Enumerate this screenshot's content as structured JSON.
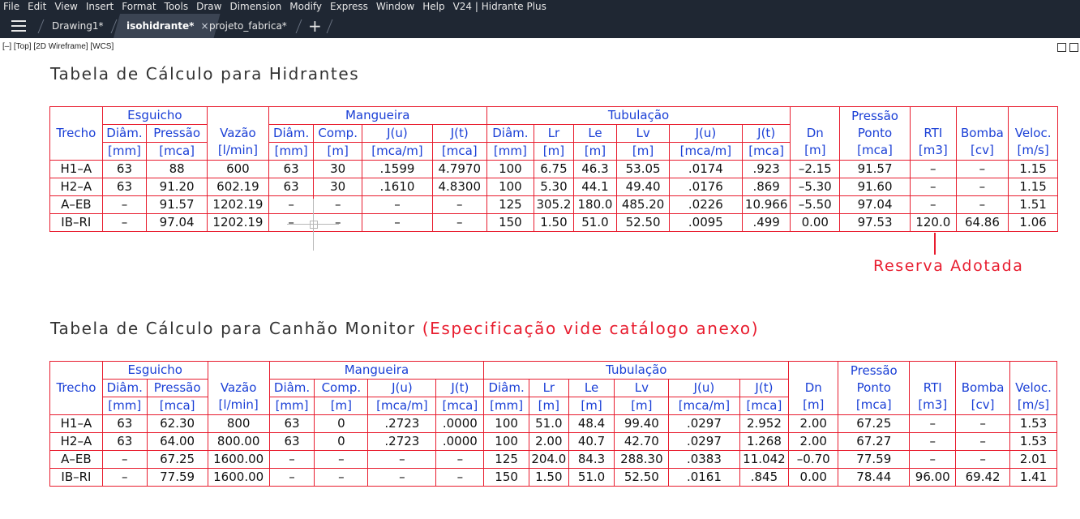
{
  "menu": [
    "File",
    "Edit",
    "View",
    "Insert",
    "Format",
    "Tools",
    "Draw",
    "Dimension",
    "Modify",
    "Express",
    "Window",
    "Help",
    "V24 | Hidrante Plus"
  ],
  "tabs": [
    {
      "label": "Drawing1*",
      "active": false
    },
    {
      "label": "isohidrante*",
      "active": true,
      "close": "×"
    },
    {
      "label": "projeto_fabrica*",
      "active": false
    }
  ],
  "new_tab": "+",
  "viewport_label": "[–] [Top] [2D Wireframe] [WCS]",
  "colors": {
    "grid": "#e81c2e",
    "header_text": "#1a3fd6",
    "value_text": "#111111",
    "annotation": "#e81c2e",
    "app_bar": "#1f2733"
  },
  "table1": {
    "title": "Tabela de Cálculo para Hidrantes",
    "groups": {
      "esguicho": "Esguicho",
      "mangueira": "Mangueira",
      "tubulacao": "Tubulação"
    },
    "headers": {
      "trecho": "Trecho",
      "e_diam": [
        "Diâm.",
        "[mm]"
      ],
      "e_pres": [
        "Pressão",
        "[mca]"
      ],
      "vazao": [
        "Vazão",
        "[l/min]"
      ],
      "m_diam": [
        "Diâm.",
        "[mm]"
      ],
      "m_comp": [
        "Comp.",
        "[m]"
      ],
      "m_ju": [
        "J(u)",
        "[mca/m]"
      ],
      "m_jt": [
        "J(t)",
        "[mca]"
      ],
      "t_diam": [
        "Diâm.",
        "[mm]"
      ],
      "t_lr": [
        "Lr",
        "[m]"
      ],
      "t_le": [
        "Le",
        "[m]"
      ],
      "t_lv": [
        "Lv",
        "[m]"
      ],
      "t_ju": [
        "J(u)",
        "[mca/m]"
      ],
      "t_jt": [
        "J(t)",
        "[mca]"
      ],
      "dn": [
        "Dn",
        "[m]"
      ],
      "pres": [
        "Pressão",
        "Ponto",
        "[mca]"
      ],
      "rti": [
        "RTI",
        "[m3]"
      ],
      "bomba": [
        "Bomba",
        "[cv]"
      ],
      "veloc": [
        "Veloc.",
        "[m/s]"
      ]
    },
    "rows": [
      [
        "H1–A",
        "63",
        "88",
        "600",
        "63",
        "30",
        ".1599",
        "4.7970",
        "100",
        "6.75",
        "46.3",
        "53.05",
        ".0174",
        ".923",
        "–2.15",
        "91.57",
        "–",
        "–",
        "1.15"
      ],
      [
        "H2–A",
        "63",
        "91.20",
        "602.19",
        "63",
        "30",
        ".1610",
        "4.8300",
        "100",
        "5.30",
        "44.1",
        "49.40",
        ".0176",
        ".869",
        "–5.30",
        "91.60",
        "–",
        "–",
        "1.15"
      ],
      [
        "A–EB",
        "–",
        "91.57",
        "1202.19",
        "–",
        "–",
        "–",
        "–",
        "125",
        "305.2",
        "180.0",
        "485.20",
        ".0226",
        "10.966",
        "–5.50",
        "97.04",
        "–",
        "–",
        "1.51"
      ],
      [
        "IB–RI",
        "–",
        "97.04",
        "1202.19",
        "–",
        "–",
        "–",
        "–",
        "150",
        "1.50",
        "51.0",
        "52.50",
        ".0095",
        ".499",
        "0.00",
        "97.53",
        "120.0",
        "64.86",
        "1.06"
      ]
    ]
  },
  "annotation": "Reserva Adotada",
  "table2": {
    "title": "Tabela de Cálculo para Canhão Monitor",
    "title_note": "(Especificação vide catálogo anexo)",
    "groups": {
      "esguicho": "Esguicho",
      "mangueira": "Mangueira",
      "tubulacao": "Tubulação"
    },
    "headers": {
      "trecho": "Trecho",
      "e_diam": [
        "Diâm.",
        "[mm]"
      ],
      "e_pres": [
        "Pressão",
        "[mca]"
      ],
      "vazao": [
        "Vazão",
        "[l/min]"
      ],
      "m_diam": [
        "Diâm.",
        "[mm]"
      ],
      "m_comp": [
        "Comp.",
        "[m]"
      ],
      "m_ju": [
        "J(u)",
        "[mca/m]"
      ],
      "m_jt": [
        "J(t)",
        "[mca]"
      ],
      "t_diam": [
        "Diâm.",
        "[mm]"
      ],
      "t_lr": [
        "Lr",
        "[m]"
      ],
      "t_le": [
        "Le",
        "[m]"
      ],
      "t_lv": [
        "Lv",
        "[m]"
      ],
      "t_ju": [
        "J(u)",
        "[mca/m]"
      ],
      "t_jt": [
        "J(t)",
        "[mca]"
      ],
      "dn": [
        "Dn",
        "[m]"
      ],
      "pres": [
        "Pressão",
        "Ponto",
        "[mca]"
      ],
      "rti": [
        "RTI",
        "[m3]"
      ],
      "bomba": [
        "Bomba",
        "[cv]"
      ],
      "veloc": [
        "Veloc.",
        "[m/s]"
      ]
    },
    "rows": [
      [
        "H1–A",
        "63",
        "62.30",
        "800",
        "63",
        "0",
        ".2723",
        ".0000",
        "100",
        "51.0",
        "48.4",
        "99.40",
        ".0297",
        "2.952",
        "2.00",
        "67.25",
        "–",
        "–",
        "1.53"
      ],
      [
        "H2–A",
        "63",
        "64.00",
        "800.00",
        "63",
        "0",
        ".2723",
        ".0000",
        "100",
        "2.00",
        "40.7",
        "42.70",
        ".0297",
        "1.268",
        "2.00",
        "67.27",
        "–",
        "–",
        "1.53"
      ],
      [
        "A–EB",
        "–",
        "67.25",
        "1600.00",
        "–",
        "–",
        "–",
        "–",
        "125",
        "204.0",
        "84.3",
        "288.30",
        ".0383",
        "11.042",
        "–0.70",
        "77.59",
        "–",
        "–",
        "2.01"
      ],
      [
        "IB–RI",
        "–",
        "77.59",
        "1600.00",
        "–",
        "–",
        "–",
        "–",
        "150",
        "1.50",
        "51.0",
        "52.50",
        ".0161",
        ".845",
        "0.00",
        "78.44",
        "96.00",
        "69.42",
        "1.41"
      ]
    ]
  }
}
